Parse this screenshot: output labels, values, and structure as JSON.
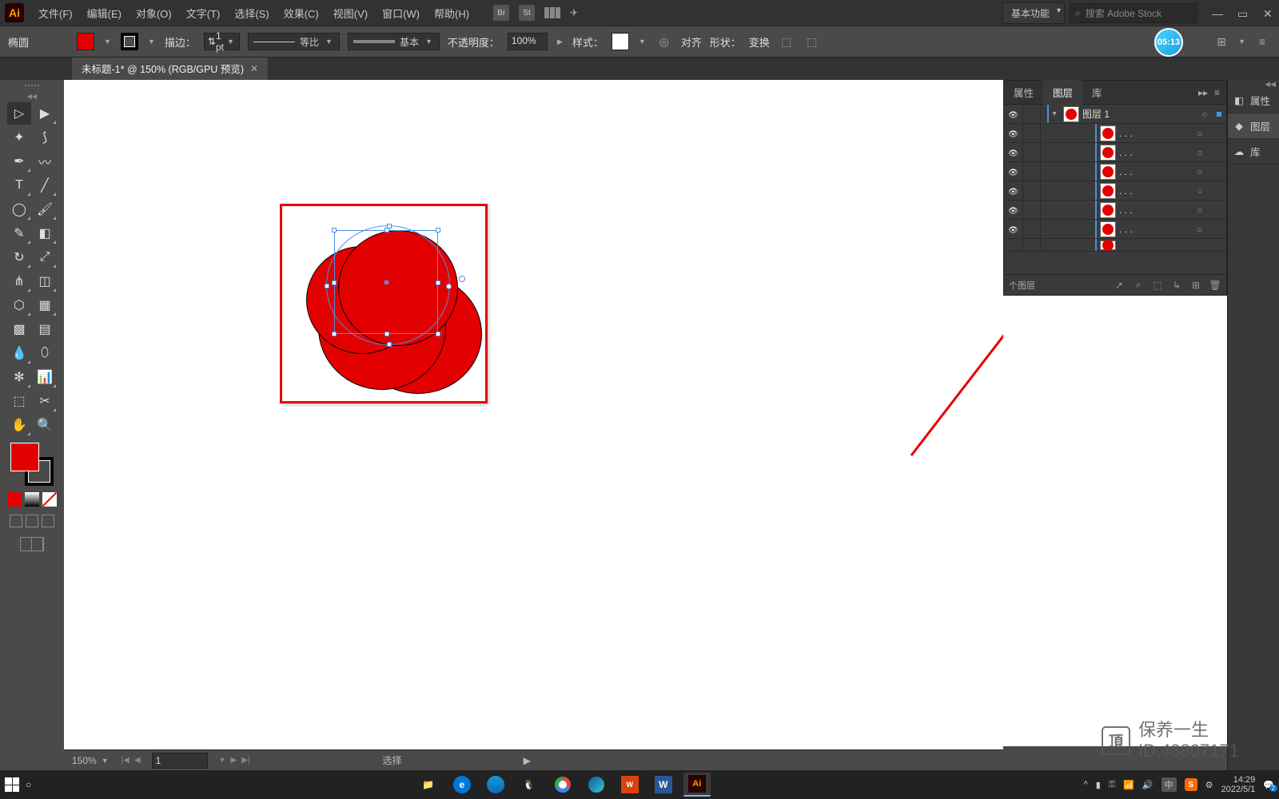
{
  "app_logo": "Ai",
  "menus": [
    "文件(F)",
    "编辑(E)",
    "对象(O)",
    "文字(T)",
    "选择(S)",
    "效果(C)",
    "视图(V)",
    "窗口(W)",
    "帮助(H)"
  ],
  "workspace": "基本功能",
  "search_placeholder": "搜索 Adobe Stock",
  "control": {
    "tool_name": "椭圆",
    "fill_color": "#e30000",
    "stroke_label": "描边：",
    "stroke_width": "1 pt",
    "variable_label": "等比",
    "basic_label": "基本",
    "opacity_label": "不透明度：",
    "opacity_value": "100%",
    "style_label": "样式：",
    "align_label": "对齐",
    "shape_label": "形状：",
    "transform_label": "变换"
  },
  "timer": "05:13",
  "doc_tab": "未标题-1* @ 150% (RGB/GPU 预览)",
  "panel": {
    "tabs": [
      "属性",
      "图层",
      "库"
    ],
    "active_tab": 1,
    "layer_name": "图层 1",
    "sublayer_label": ". . .",
    "sublayers": 6,
    "footer": "个图层"
  },
  "collapsed": [
    {
      "icon": "◧",
      "label": "属性"
    },
    {
      "icon": "◆",
      "label": "图层"
    },
    {
      "icon": "☁",
      "label": "库"
    }
  ],
  "status": {
    "zoom": "150%",
    "artboard": "1",
    "tool": "选择"
  },
  "taskbar": {
    "time": "14:29",
    "date": "2022/5/1",
    "ime": "中",
    "notif": "2"
  },
  "watermark": {
    "line1": "保养一生",
    "line2": "ID:48807171"
  }
}
